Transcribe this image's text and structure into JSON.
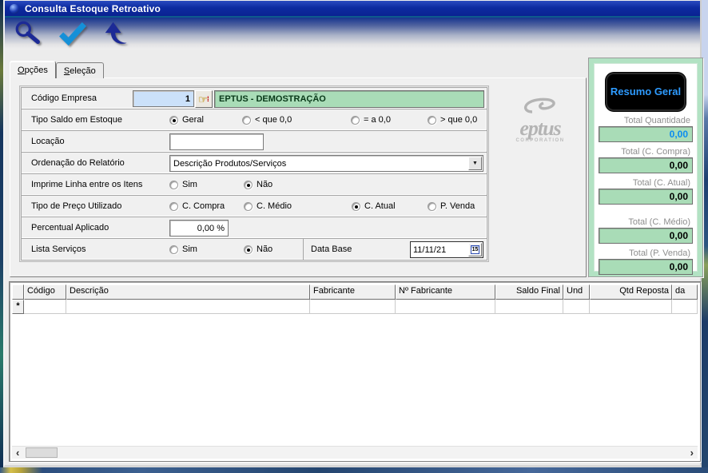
{
  "window": {
    "title": "Consulta Estoque Retroativo"
  },
  "toolbar": {
    "icons": [
      "search-icon",
      "confirm-check-icon",
      "back-arrow-icon"
    ]
  },
  "tabs": [
    {
      "label": "Opções"
    },
    {
      "label": "Seleção"
    }
  ],
  "form": {
    "codigo_empresa": {
      "label": "Código Empresa",
      "value": "1",
      "empresa": "EPTUS - DEMOSTRAÇÃO"
    },
    "tipo_saldo": {
      "label": "Tipo Saldo em Estoque",
      "options": [
        "Geral",
        "< que  0,0",
        "= a 0,0",
        "> que 0,0"
      ],
      "selected": "Geral"
    },
    "locacao": {
      "label": "Locação",
      "value": ""
    },
    "ordenacao": {
      "label": "Ordenação do Relatório",
      "value": "Descrição Produtos/Serviços",
      "dropdown_glyph": "▼"
    },
    "imprime_linha": {
      "label": "Imprime Linha entre os Itens",
      "options": [
        "Sim",
        "Não"
      ],
      "selected": "Não"
    },
    "tipo_preco": {
      "label": "Tipo de Preço Utilizado",
      "options": [
        "C. Compra",
        "C. Médio",
        "C. Atual",
        "P. Venda"
      ],
      "selected": "C. Atual"
    },
    "percentual": {
      "label": "Percentual Aplicado",
      "value": "0,00 %"
    },
    "lista_servicos": {
      "label": "Lista Serviços",
      "options": [
        "Sim",
        "Não"
      ],
      "selected": "Não"
    },
    "data_base": {
      "label": "Data Base",
      "value": "11/11/21",
      "calendar_icon_text": "15"
    },
    "lookup_hand_glyph": "☞",
    "lookup_dots_glyph": "⁞"
  },
  "summary": {
    "button_label": "Resumo Geral",
    "items": [
      {
        "label": "Total Quantidade",
        "value": "0,00",
        "color": "#0b8cf0"
      },
      {
        "label": "Total (C. Compra)",
        "value": "0,00",
        "color": "#000000"
      },
      {
        "label": "Total (C. Atual)",
        "value": "0,00",
        "color": "#000000"
      },
      {
        "label": "Total (C. Médio)",
        "value": "0,00",
        "color": "#000000"
      },
      {
        "label": "Total (P. Venda)",
        "value": "0,00",
        "color": "#000000"
      }
    ]
  },
  "brand": {
    "name": "eptus",
    "subtitle": "CORPORATION"
  },
  "grid": {
    "columns": [
      {
        "label": ""
      },
      {
        "label": "Código"
      },
      {
        "label": "Descrição"
      },
      {
        "label": "Fabricante"
      },
      {
        "label": "Nº Fabricante"
      },
      {
        "label": "Saldo Final"
      },
      {
        "label": "Und"
      },
      {
        "label": "Qtd Reposta"
      },
      {
        "label": "da"
      }
    ],
    "new_row_indicator": "*",
    "scroll_left_glyph": "‹",
    "scroll_right_glyph": "›"
  }
}
